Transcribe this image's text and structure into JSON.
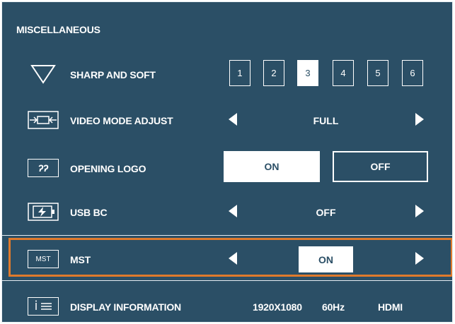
{
  "menu_title": "MISCELLANEOUS",
  "accent_color": "#e07a2c",
  "panel_color": "#2b4f66",
  "rows": {
    "sharpness": {
      "label": "SHARP AND SOFT",
      "icon": "triangle-down-icon",
      "options": [
        "1",
        "2",
        "3",
        "4",
        "5",
        "6"
      ],
      "selected": "3"
    },
    "video_mode": {
      "label": "VIDEO MODE ADJUST",
      "icon": "aspect-ratio-icon",
      "value": "FULL"
    },
    "opening_logo": {
      "label": "OPENING LOGO",
      "icon": "logo-icon",
      "icon_text": "ʔʔ",
      "on_label": "ON",
      "off_label": "OFF",
      "selected": "ON"
    },
    "usb_bc": {
      "label": "USB BC",
      "icon": "battery-charge-icon",
      "value": "OFF"
    },
    "mst": {
      "label": "MST",
      "icon_text": "MST",
      "value": "ON"
    },
    "display_info": {
      "label": "DISPLAY INFORMATION",
      "icon": "info-icon",
      "resolution": "1920X1080",
      "refresh": "60Hz",
      "input": "HDMI"
    }
  }
}
